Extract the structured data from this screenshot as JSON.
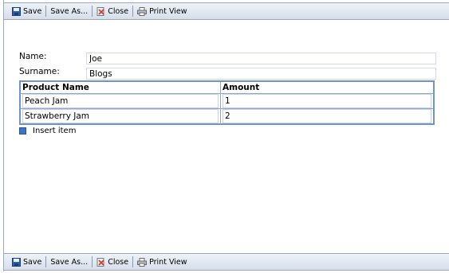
{
  "toolbar": {
    "save_label": "Save",
    "save_as_label": "Save As...",
    "close_label": "Close",
    "print_view_label": "Print View"
  },
  "form": {
    "name_label": "Name:",
    "name_value": "Joe",
    "surname_label": "Surname:",
    "surname_value": "Blogs"
  },
  "table": {
    "headers": [
      "Product Name",
      "Amount"
    ],
    "rows": [
      [
        "Peach Jam",
        "1"
      ],
      [
        "Strawberry Jam",
        "2"
      ]
    ]
  },
  "insert_item_label": "Insert item",
  "colors": {
    "toolbar_border": "#9aa7bd",
    "table_border": "#6f94c7",
    "save_icon": "#2f5fa8",
    "close_icon": "#c8402a"
  },
  "icons": [
    "save-icon",
    "close-icon",
    "print-icon",
    "insert-icon"
  ]
}
